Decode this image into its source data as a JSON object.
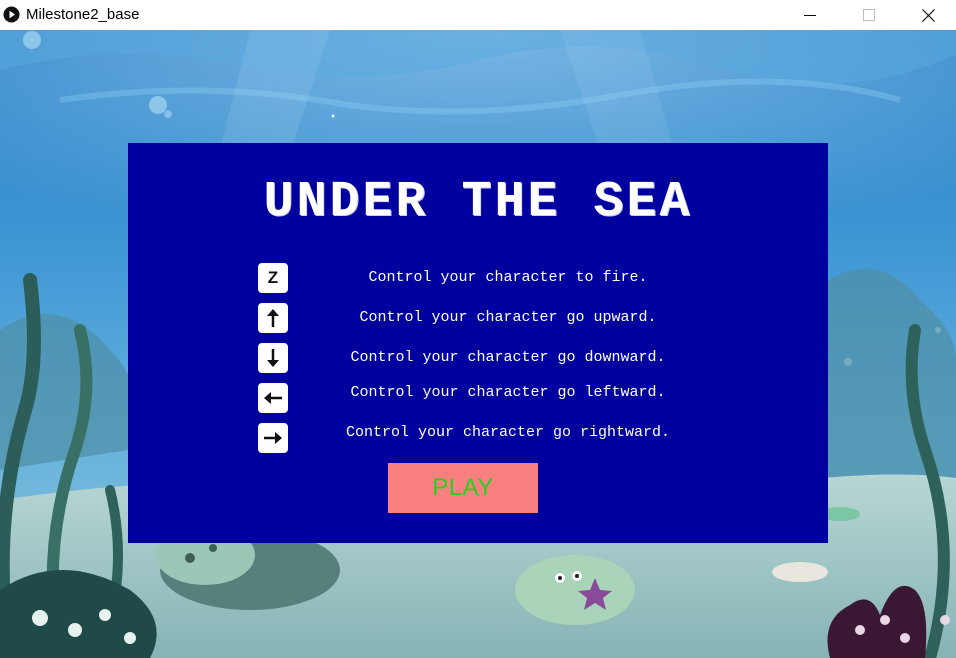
{
  "window": {
    "title": "Milestone2_base"
  },
  "game": {
    "title": "UNDER THE SEA",
    "controls": [
      {
        "key": "Z",
        "icon": "z-key-icon",
        "text": "Control your character to fire."
      },
      {
        "key": "↑",
        "icon": "arrow-up-icon",
        "text": "Control your character go upward."
      },
      {
        "key": "↓",
        "icon": "arrow-down-icon",
        "text": "Control your character go downward."
      },
      {
        "key": "←",
        "icon": "arrow-left-icon",
        "text": "Control your character go leftward."
      },
      {
        "key": "→",
        "icon": "arrow-right-icon",
        "text": "Control your character go rightward."
      }
    ],
    "play_label": "PLAY"
  },
  "colors": {
    "panel": "#00009e",
    "play_button": "#fa8080",
    "play_text": "#1fd41f",
    "sea_top": "#2f86c9",
    "sea_floor": "#9ec7c8"
  }
}
